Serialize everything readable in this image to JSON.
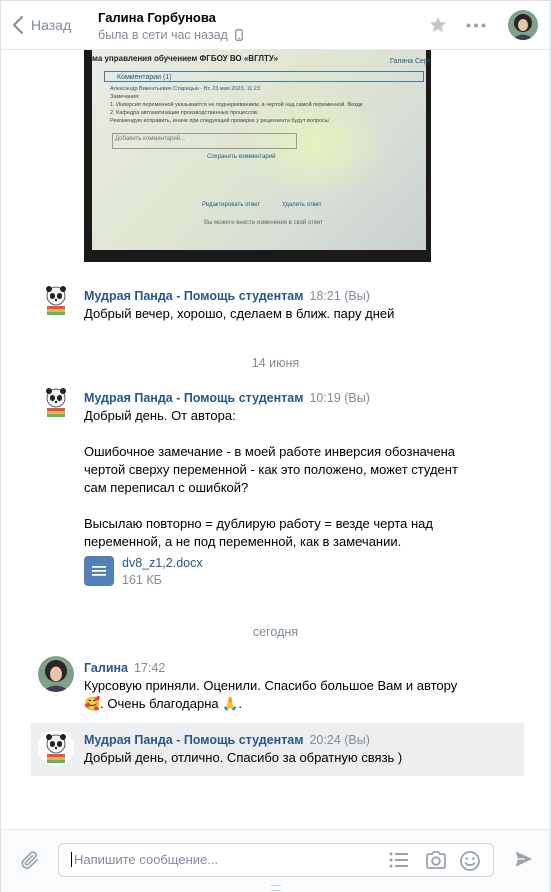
{
  "header": {
    "back_label": "Назад",
    "contact_name": "Галина Горбунова",
    "contact_status": "была в сети час назад",
    "icons": [
      "back-chevron-icon",
      "phone-icon",
      "star-icon",
      "more-icon",
      "avatar"
    ]
  },
  "photo": {
    "title": "ма управления обучением ФГБОУ ВО «ВГЛТУ»",
    "user": "Галина Серг",
    "comments_bar": "Комментарии (1)",
    "lines": [
      "Александр Викентьевич Старицын - Вт. 23 мая 2023, 11:23",
      "Замечания:",
      "1. Инверсия переменной указывается не подчеркиванием, а чертой над самой переменной. Везде",
      "2. Кафедра автоматизации производственных процессов.",
      "Рекомендую исправить, иначе при следующей проверке у рецензента будут вопросы"
    ],
    "comment_placeholder": "Добавить комментарий...",
    "save_link": "Сохранить комментарий",
    "edit_link": "Редактировать ответ",
    "delete_link": "Удалить ответ",
    "note": "Вы можете внести изменения в свой ответ"
  },
  "messages": [
    {
      "author": "Мудрая Панда - Помощь студентам",
      "time": "18:21 (Вы)",
      "text": "Добрый вечер, хорошо, сделаем в ближ. пару дней"
    },
    {
      "author": "Мудрая Панда - Помощь студентам",
      "time": "10:19 (Вы)",
      "text": "Добрый день. От автора:\n\nОшибочное замечание - в моей работе инверсия обозначена\nчертой сверху переменной - как это положено, может студент\nсам переписал с ошибкой?\n\nВысылаю повторно = дублирую работу = везде черта над\nпеременной, а не под переменной, как в замечании.",
      "attachment": {
        "name": "dv8_z1,2.docx",
        "size": "161 КБ"
      }
    },
    {
      "author": "Галина",
      "time": "17:42",
      "text": "Курсовую приняли. Оценили. Спасибо большое Вам и автору\n🥰. Очень благодарна 🙏."
    },
    {
      "author": "Мудрая Панда - Помощь студентам",
      "time": "20:24 (Вы)",
      "text": "Добрый день, отлично. Спасибо за обратную связь )"
    }
  ],
  "day_separators": [
    "14 июня",
    "сегодня"
  ],
  "composer": {
    "placeholder": "Напишите сообщение...",
    "icons": [
      "attach-icon",
      "list-icon",
      "camera-icon",
      "emoji-icon",
      "send-icon"
    ]
  },
  "colors": {
    "link": "#2a5885",
    "muted": "#818c99",
    "highlight": "#edeef0",
    "doc_icon": "#5181b8"
  }
}
